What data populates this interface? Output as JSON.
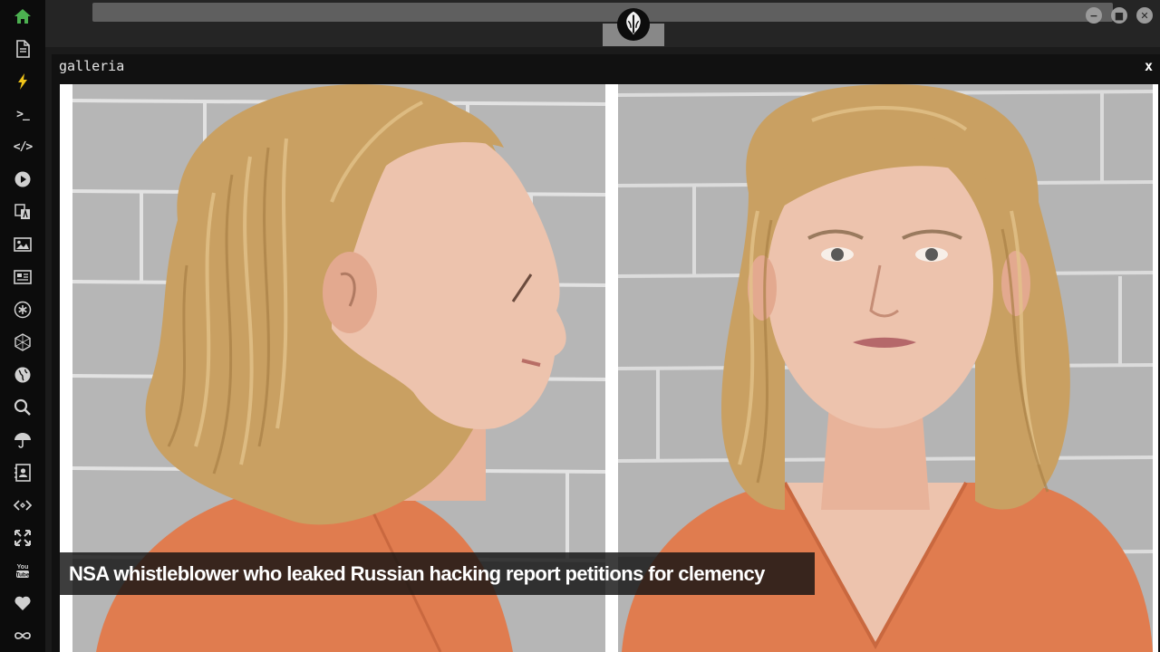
{
  "sidebar": {
    "items": [
      {
        "name": "home-icon",
        "accent": "#4cb050"
      },
      {
        "name": "document-icon"
      },
      {
        "name": "lightning-icon",
        "accent": "#f0c419"
      },
      {
        "name": "terminal-icon",
        "text": ">_"
      },
      {
        "name": "code-icon",
        "text": "</>"
      },
      {
        "name": "play-icon"
      },
      {
        "name": "translate-icon"
      },
      {
        "name": "image-icon"
      },
      {
        "name": "news-icon"
      },
      {
        "name": "asterisk-icon"
      },
      {
        "name": "hexagon-icon"
      },
      {
        "name": "globe-icon"
      },
      {
        "name": "search-icon"
      },
      {
        "name": "umbrella-icon"
      },
      {
        "name": "contact-icon"
      },
      {
        "name": "embed-icon"
      },
      {
        "name": "expand-icon"
      },
      {
        "name": "youtube-icon",
        "text": "You Tube"
      },
      {
        "name": "heart-icon"
      },
      {
        "name": "infinity-icon"
      }
    ]
  },
  "topbar": {
    "logo": "rebel-alliance-icon"
  },
  "window": {
    "title": "galleria",
    "close_label": "x"
  },
  "gallery": {
    "caption": "NSA whistleblower who leaked Russian hacking report petitions for clemency"
  },
  "colors": {
    "rail_bg": "#0c0c0c",
    "topbar_bg": "#252525",
    "frame_bg": "#111111",
    "jumpsuit": "#e07c4f",
    "hair": "#c9a062",
    "wall": "#b9b9b9"
  }
}
